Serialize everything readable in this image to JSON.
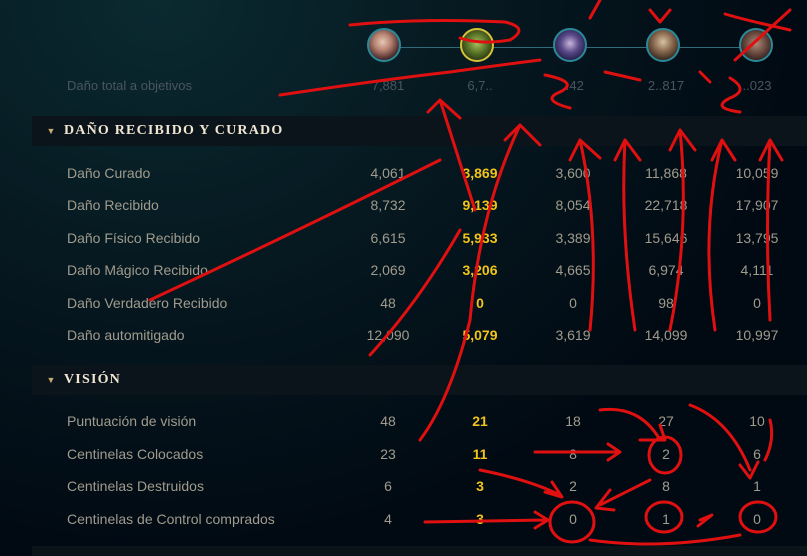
{
  "colors": {
    "accent_gold": "#f0c419",
    "header_text": "#f0e6d2",
    "label": "#a09b8c",
    "annotation": "#e01010"
  },
  "champions": [
    {
      "name": "champion-1",
      "selected": false
    },
    {
      "name": "champion-2",
      "selected": true
    },
    {
      "name": "champion-3",
      "selected": false
    },
    {
      "name": "champion-4",
      "selected": false
    },
    {
      "name": "champion-5",
      "selected": false
    }
  ],
  "faded_row": {
    "label": "Daño total a objetivos",
    "values": [
      "7,881",
      "6,7..",
      "..42",
      "2..817",
      "..023"
    ]
  },
  "sections": [
    {
      "title": "DAÑO RECIBIDO Y CURADO",
      "rows": [
        {
          "label": "Daño Curado",
          "values": [
            "4,061",
            "3,869",
            "3,600",
            "11,868",
            "10,059"
          ]
        },
        {
          "label": "Daño Recibido",
          "values": [
            "8,732",
            "9,139",
            "8,054",
            "22,718",
            "17,907"
          ]
        },
        {
          "label": "Daño Físico Recibido",
          "values": [
            "6,615",
            "5,933",
            "3,389",
            "15,646",
            "13,795"
          ]
        },
        {
          "label": "Daño Mágico Recibido",
          "values": [
            "2,069",
            "3,206",
            "4,665",
            "6,974",
            "4,111"
          ]
        },
        {
          "label": "Daño Verdadero Recibido",
          "values": [
            "48",
            "0",
            "0",
            "98",
            "0"
          ]
        },
        {
          "label": "Daño automitigado",
          "values": [
            "12,090",
            "5,079",
            "3,619",
            "14,099",
            "10,997"
          ]
        }
      ]
    },
    {
      "title": "VISIÓN",
      "rows": [
        {
          "label": "Puntuación de visión",
          "values": [
            "48",
            "21",
            "18",
            "27",
            "10"
          ]
        },
        {
          "label": "Centinelas Colocados",
          "values": [
            "23",
            "11",
            "8",
            "2",
            "6"
          ]
        },
        {
          "label": "Centinelas Destruidos",
          "values": [
            "6",
            "3",
            "2",
            "8",
            "1"
          ]
        },
        {
          "label": "Centinelas de Control comprados",
          "values": [
            "4",
            "3",
            "0",
            "1",
            "0"
          ]
        }
      ]
    }
  ]
}
